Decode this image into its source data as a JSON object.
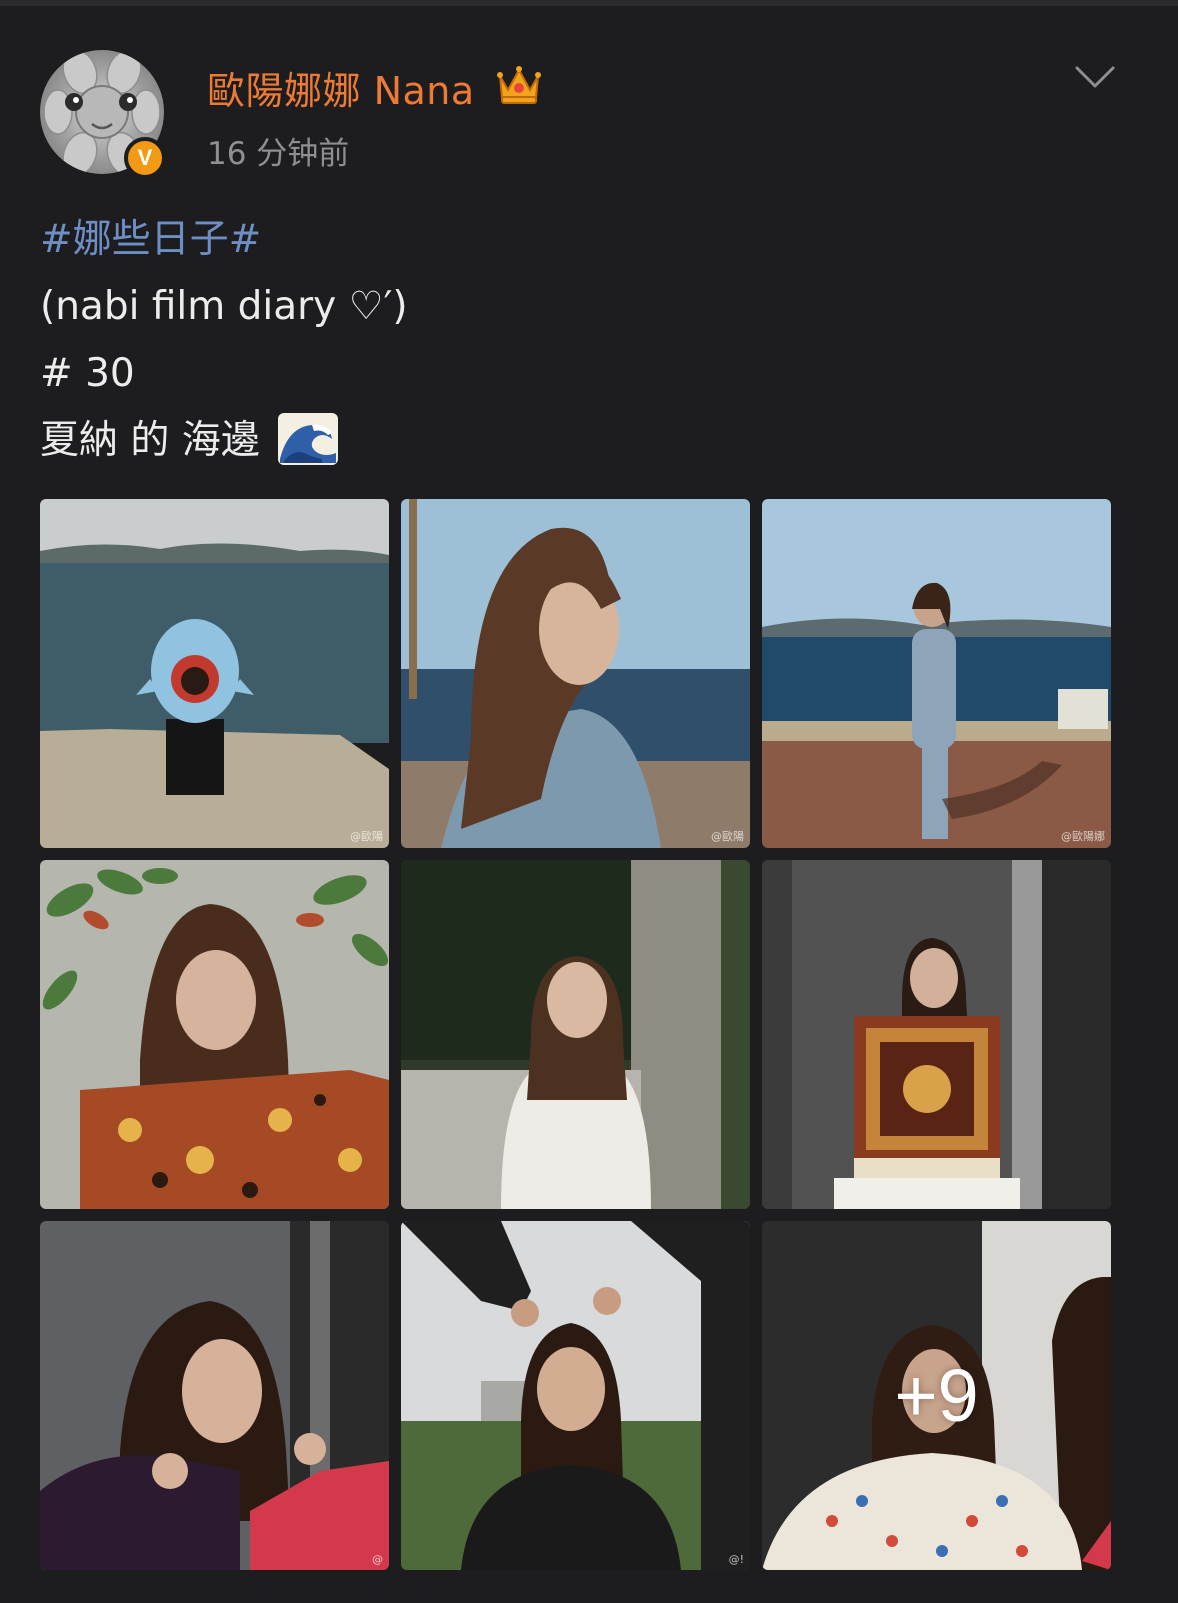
{
  "post": {
    "author": {
      "name": "歐陽娜娜 Nana",
      "verified_badge": "V",
      "crown_icon": "crown-icon"
    },
    "timestamp": "16 分钟前",
    "menu_icon": "chevron-down-icon",
    "text": {
      "hashtag": "#娜些日子#",
      "line2": "(nabi film diary ♡′)",
      "line3": "# 30",
      "line4": "夏納 的 海邊",
      "emoji": "wave-emoji"
    },
    "images": {
      "count_shown": 9,
      "more_label": "+9",
      "watermarks": [
        "@歐陽",
        "@歐陽",
        "@歐陽娜",
        "",
        "",
        "",
        "@",
        "@!",
        ""
      ]
    }
  },
  "colors": {
    "background": "#1d1d1f",
    "username": "#ee7b35",
    "hashtag": "#6d8fc4",
    "text": "#ececec",
    "timestamp": "#8e8e93",
    "verified": "#f29a13"
  }
}
